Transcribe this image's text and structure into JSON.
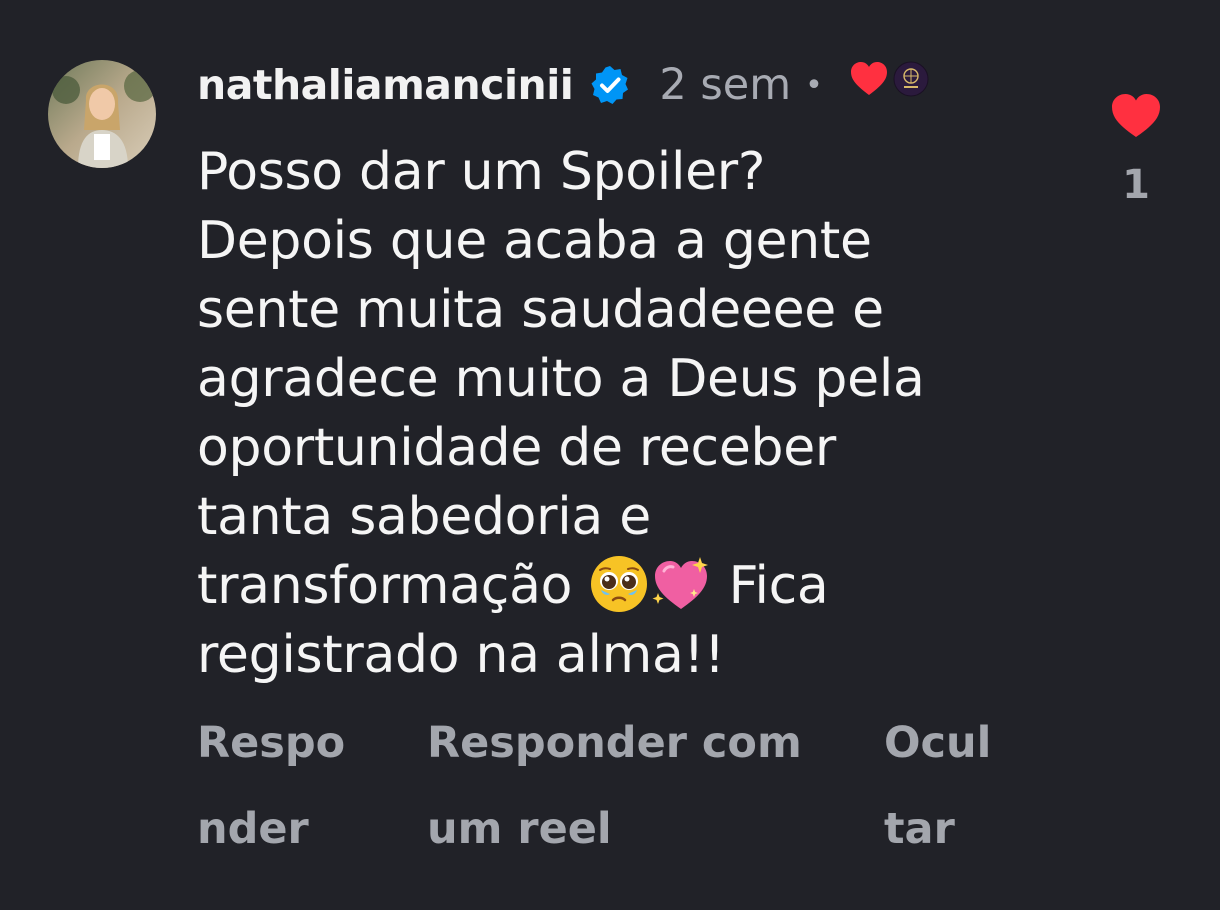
{
  "comment": {
    "username": "nathaliamancinii",
    "verified": true,
    "time": "2 sem",
    "separator": "•",
    "liked_by_creator": true,
    "body_lines": [
      "Posso dar um Spoiler?",
      "Depois que acaba a gente",
      "sente muita saudadeeee e",
      "agradece muito a Deus pela",
      "oportunidade de receber",
      "tanta sabedoria e",
      "transformação",
      "Fica",
      "registrado na alma!!"
    ],
    "emojis": [
      "pleading-face-emoji",
      "sparkling-heart-emoji"
    ],
    "likes": "1"
  },
  "actions": {
    "reply": [
      "Respo",
      "nder"
    ],
    "reply_reel": [
      "Responder com",
      "um reel"
    ],
    "hide": [
      "Ocul",
      "tar"
    ]
  },
  "colors": {
    "background": "#212228",
    "text": "#f5f5f5",
    "muted": "#a3a6ad",
    "heart": "#ff3040",
    "verified": "#0095f6"
  },
  "icons": {
    "verified": "verified-badge-icon",
    "creator_like": "heart-icon",
    "like": "heart-icon"
  }
}
